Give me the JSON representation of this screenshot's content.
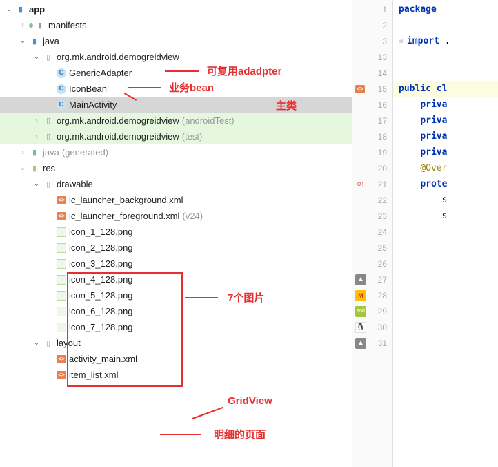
{
  "tree": {
    "app": "app",
    "manifests": "manifests",
    "java": "java",
    "pkg_main": "org.mk.android.demogreidview",
    "class_adapter": "GenericAdapter",
    "class_bean": "IconBean",
    "class_main": "MainActivity",
    "pkg_test1": "org.mk.android.demogreidview",
    "pkg_test1_suffix": "(androidTest)",
    "pkg_test2": "org.mk.android.demogreidview",
    "pkg_test2_suffix": "(test)",
    "java_gen": "java",
    "java_gen_suffix": "(generated)",
    "res": "res",
    "drawable": "drawable",
    "ic_bg": "ic_launcher_background.xml",
    "ic_fg": "ic_launcher_foreground.xml",
    "ic_fg_suffix": "(v24)",
    "icon1": "icon_1_128.png",
    "icon2": "icon_2_128.png",
    "icon3": "icon_3_128.png",
    "icon4": "icon_4_128.png",
    "icon5": "icon_5_128.png",
    "icon6": "icon_6_128.png",
    "icon7": "icon_7_128.png",
    "layout": "layout",
    "activity_main": "activity_main.xml",
    "item_list": "item_list.xml"
  },
  "annotations": {
    "adapter": "可复用adadpter",
    "bean": "业务bean",
    "main_class": "主类",
    "images": "7个图片",
    "gridview": "GridView",
    "detail": "明细的页面"
  },
  "gutter_lines": [
    "1",
    "2",
    "3",
    "13",
    "14",
    "15",
    "16",
    "17",
    "18",
    "19",
    "20",
    "21",
    "22",
    "23",
    "24",
    "25",
    "26",
    "27",
    "28",
    "29",
    "30",
    "31"
  ],
  "code": {
    "package": "package",
    "import": "import",
    "import_dots": ".",
    "public": "public",
    "cl_prefix": "cl",
    "priva": "priva",
    "override": "@Over",
    "prote": "prote",
    "s": "s"
  }
}
